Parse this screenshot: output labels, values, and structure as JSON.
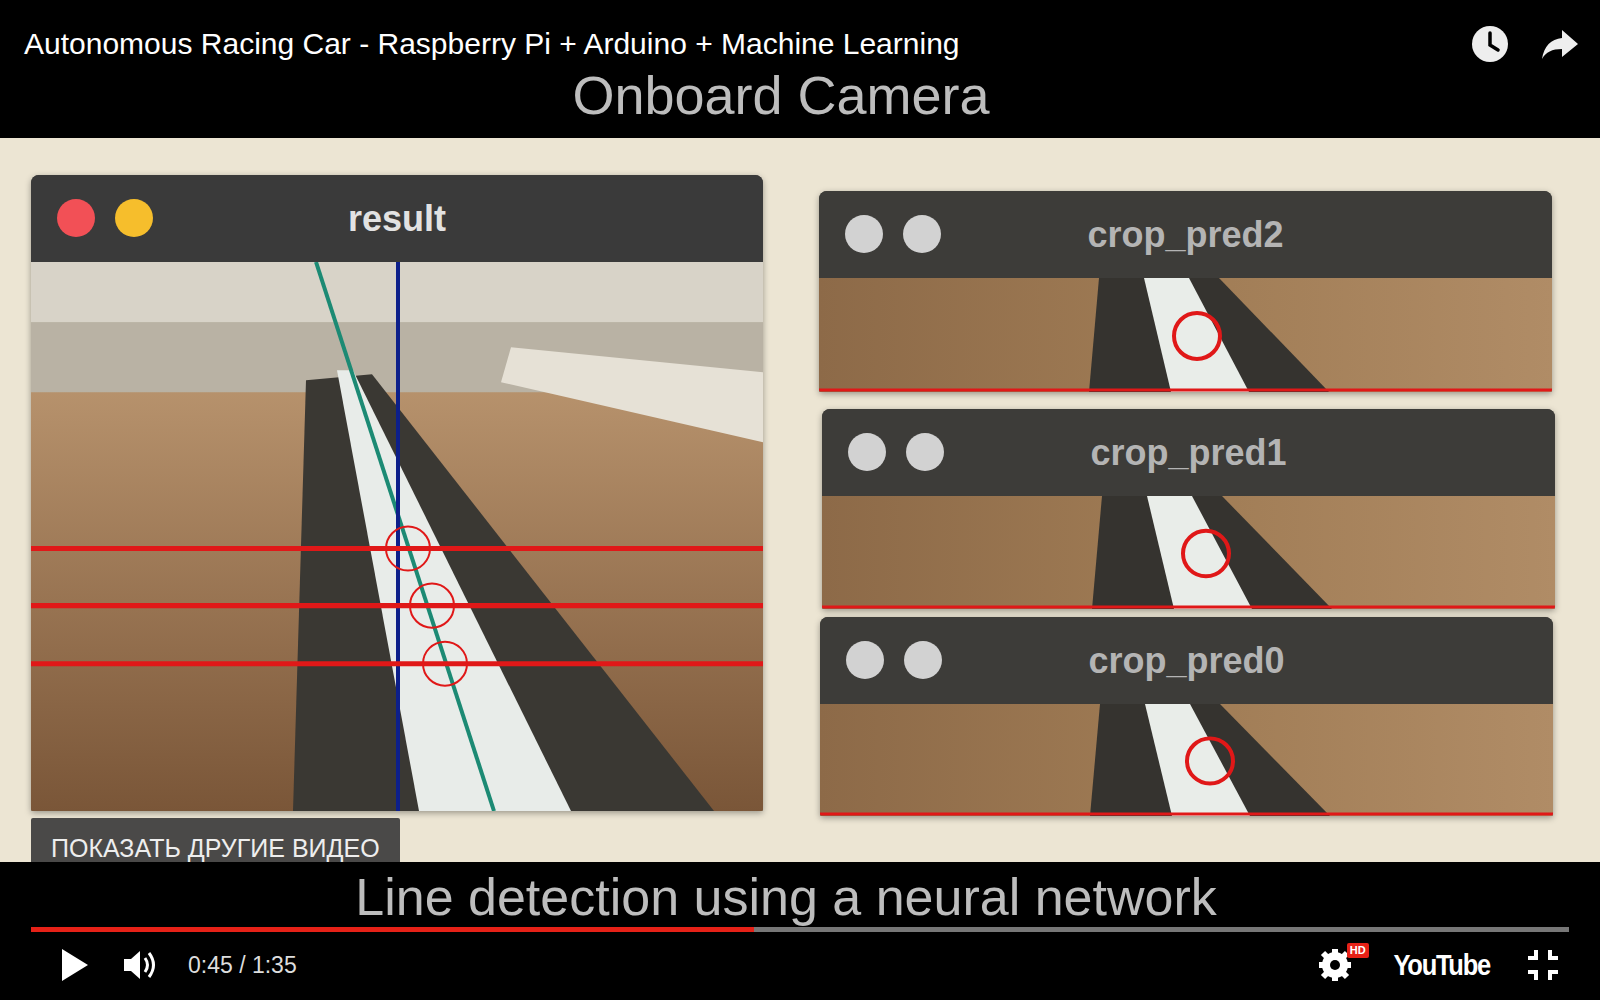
{
  "video": {
    "title": "Autonomous Racing Car - Raspberry Pi + Arduino + Machine Learning",
    "top_caption": "Onboard Camera",
    "bottom_caption": "Line detection using a neural network",
    "windows": [
      {
        "title": "result",
        "active": true
      },
      {
        "title": "crop_pred2",
        "active": false
      },
      {
        "title": "crop_pred1",
        "active": false
      },
      {
        "title": "crop_pred0",
        "active": false
      }
    ]
  },
  "more_videos_button": "ПОКАЗАТЬ ДРУГИЕ ВИДЕО",
  "player": {
    "progress": 0.47,
    "time": "0:45 / 1:35",
    "hd_badge": "HD",
    "logo": "YouTube"
  }
}
